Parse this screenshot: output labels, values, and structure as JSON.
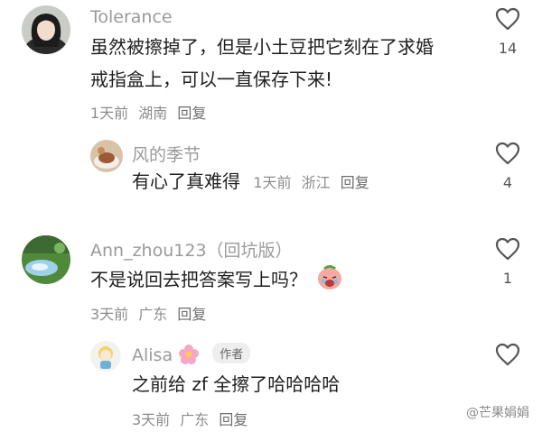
{
  "comments": [
    {
      "username": "Tolerance",
      "text_lines": [
        "虽然被擦掉了，但是小土豆把它刻在了求婚",
        "戒指盒上，可以一直保存下来!"
      ],
      "time": "1天前",
      "location": "湖南",
      "reply_label": "回复",
      "likes": "14",
      "avatar_icon": "person-avatar-icon"
    },
    {
      "username": "风的季节",
      "text": "有心了真难得",
      "time": "1天前",
      "location": "浙江",
      "reply_label": "回复",
      "likes": "4",
      "avatar_icon": "food-avatar-icon"
    },
    {
      "username": "Ann_zhou123（回坑版）",
      "text": "不是说回去把答案写上吗？",
      "emoji": "crying-face-emoji",
      "time": "3天前",
      "location": "广东",
      "reply_label": "回复",
      "likes": "1",
      "avatar_icon": "landscape-avatar-icon"
    },
    {
      "username": "Alisa",
      "name_emoji": "flower-emoji",
      "badge": "作者",
      "text": "之前给 zf 全擦了哈哈哈哈",
      "time": "3天前",
      "location": "广东",
      "reply_label": "回复",
      "likes": "",
      "avatar_icon": "cartoon-avatar-icon"
    }
  ],
  "watermark": "@芒果娟娟",
  "colors": {
    "name": "#9a9a9a",
    "text": "#1f1f1f",
    "meta": "#8c8c8c"
  }
}
